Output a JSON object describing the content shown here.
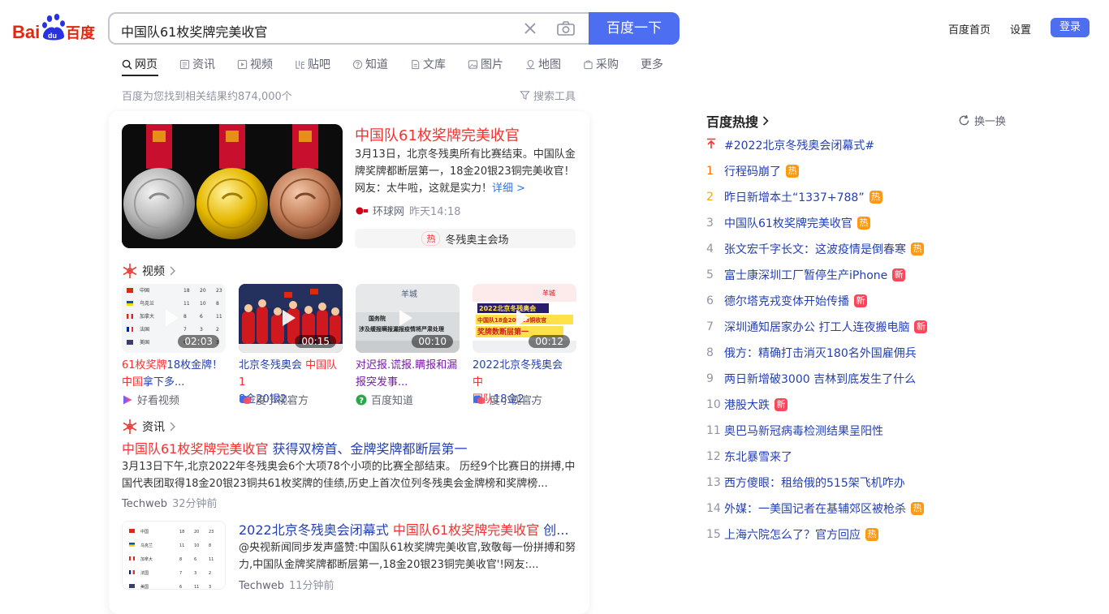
{
  "header": {
    "logo_text": "Bai百度",
    "search_value": "中国队61枚奖牌完美收官",
    "search_button": "百度一下",
    "links": [
      "百度首页",
      "设置"
    ],
    "login": "登录"
  },
  "tabs": [
    {
      "label": "网页",
      "icon": "search-icon",
      "active": true
    },
    {
      "label": "资讯",
      "icon": "news-icon"
    },
    {
      "label": "视频",
      "icon": "video-icon"
    },
    {
      "label": "贴吧",
      "icon": "tieba-icon"
    },
    {
      "label": "知道",
      "icon": "question-icon"
    },
    {
      "label": "文库",
      "icon": "document-icon"
    },
    {
      "label": "图片",
      "icon": "image-icon"
    },
    {
      "label": "地图",
      "icon": "map-icon"
    },
    {
      "label": "采购",
      "icon": "shop-icon"
    },
    {
      "label": "更多"
    }
  ],
  "result_count": "百度为您找到相关结果约874,000个",
  "search_tools": "搜索工具",
  "top_result": {
    "title": "中国队61枚奖牌完美收官",
    "desc": "3月13日，北京冬残奥所有比赛结束。中国队金牌奖牌都断层第一，18金20银23铜完美收官！网友：太牛啦，这就是实力！",
    "detail_link": "详细 >",
    "source": "环球网",
    "time": "昨天14:18",
    "hot_badge": "热",
    "hot_label": "冬残奥主会场"
  },
  "video_section": {
    "heading": "视频",
    "items": [
      {
        "duration": "02:03",
        "title_hl": "61枚奖牌",
        "title_rest": "18枚金牌！",
        "title_line2_hl": "中国",
        "title_line2_rest": "拿下多...",
        "source": "好看视频"
      },
      {
        "duration": "00:15",
        "title_hl": "",
        "title_rest": "北京冬残奥会 ",
        "title_line2_hl": "中国队1",
        "title_line2_rest": "8金20银2...",
        "source": "度小视官方"
      },
      {
        "duration": "00:10",
        "title_rest": "对迟报.谎报.瞒报和漏报突发事...",
        "source": "百度知道"
      },
      {
        "duration": "00:12",
        "title_rest": "2022北京冬残奥会 ",
        "title_line2_hl": "中国队",
        "title_line2_rest": "18金2...",
        "source": "度小视官方"
      }
    ]
  },
  "news_section": {
    "heading": "资讯",
    "item1": {
      "title_hl": "中国队61枚奖牌完美收官",
      "title_rest": " 获得双榜首、金牌奖牌都断层第一",
      "desc": "3月13日下午,北京2022年冬残奥会6个大项78个小项的比赛全部结束。 历经9个比赛日的拼搏,中国代表团取得18金20银23铜共61枚奖牌的佳绩,历史上首次位列冬残奥会金牌榜和奖牌榜...",
      "source": "Techweb",
      "time": "32分钟前"
    },
    "item2": {
      "title_pre": "2022北京冬残奥会闭幕式 ",
      "title_hl": "中国队61枚奖牌完美收官",
      "title_rest": " 创...",
      "desc": "@央视新闻同步发声盛赞:中国队61枚奖牌完美收官,致敬每一份拼搏和努力,中国队金牌奖牌都断层第一,18金20银23铜完美收官'!网友:...",
      "source": "Techweb",
      "time": "11分钟前"
    }
  },
  "hot_list": {
    "heading": "百度热搜",
    "refresh": "换一换",
    "items": [
      {
        "rank": "",
        "text": "#2022北京冬残奥会闭幕式#",
        "badge": ""
      },
      {
        "rank": "1",
        "text": "行程码崩了",
        "badge": "热"
      },
      {
        "rank": "2",
        "text": "昨日新增本土“1337+788”",
        "badge": "热"
      },
      {
        "rank": "3",
        "text": "中国队61枚奖牌完美收官",
        "badge": "热"
      },
      {
        "rank": "4",
        "text": "张文宏千字长文：这波疫情是倒春寒",
        "badge": "热"
      },
      {
        "rank": "5",
        "text": "富士康深圳工厂暂停生产iPhone",
        "badge": "新"
      },
      {
        "rank": "6",
        "text": "德尔塔克戎变体开始传播",
        "badge": "新"
      },
      {
        "rank": "7",
        "text": "深圳通知居家办公 打工人连夜搬电脑",
        "badge": "新"
      },
      {
        "rank": "8",
        "text": "俄方：精确打击消灭180名外国雇佣兵",
        "badge": ""
      },
      {
        "rank": "9",
        "text": "两日新增破3000 吉林到底发生了什么",
        "badge": ""
      },
      {
        "rank": "10",
        "text": "港股大跌",
        "badge": "新"
      },
      {
        "rank": "11",
        "text": "奥巴马新冠病毒检测结果呈阳性",
        "badge": ""
      },
      {
        "rank": "12",
        "text": "东北暴雪来了",
        "badge": ""
      },
      {
        "rank": "13",
        "text": "西方傻眼：租给俄的515架飞机咋办",
        "badge": ""
      },
      {
        "rank": "14",
        "text": "外媒：一美国记者在基辅郊区被枪杀",
        "badge": "热"
      },
      {
        "rank": "15",
        "text": "上海六院怎么了？官方回应",
        "badge": "热"
      }
    ]
  },
  "colors": {
    "brand": "#4e6ef2",
    "highlight": "#f73131",
    "link": "#2440b3"
  }
}
